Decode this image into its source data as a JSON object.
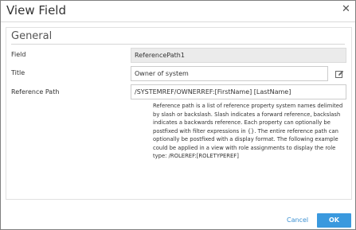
{
  "dialog": {
    "title": "View Field",
    "close_glyph": "✕"
  },
  "section": {
    "title": "General"
  },
  "fields": {
    "field_label": "Field",
    "field_value": "ReferencePath1",
    "title_label": "Title",
    "title_value": "Owner of system",
    "reference_label": "Reference Path",
    "reference_value": "/SYSTEMREF/OWNERREF:[FirstName] [LastName]"
  },
  "help": {
    "text": "Reference path is a list of reference property system names delimited by slash or backslash. Slash indicates a forward reference, backslash indicates a backwards reference. Each property can optionally be postfixed with filter expressions in {}. The entire reference path can optionally be postfixed with a display format. The following example could be applied in a view with role assignments to display the role type: /ROLEREF:[ROLETYPEREF]"
  },
  "footer": {
    "cancel_label": "Cancel",
    "ok_label": "OK"
  },
  "icons": {
    "edit": "edit-icon",
    "close": "close-icon"
  },
  "colors": {
    "accent": "#3a99de",
    "link": "#3a8fd1",
    "readonly_bg": "#ebebeb"
  }
}
